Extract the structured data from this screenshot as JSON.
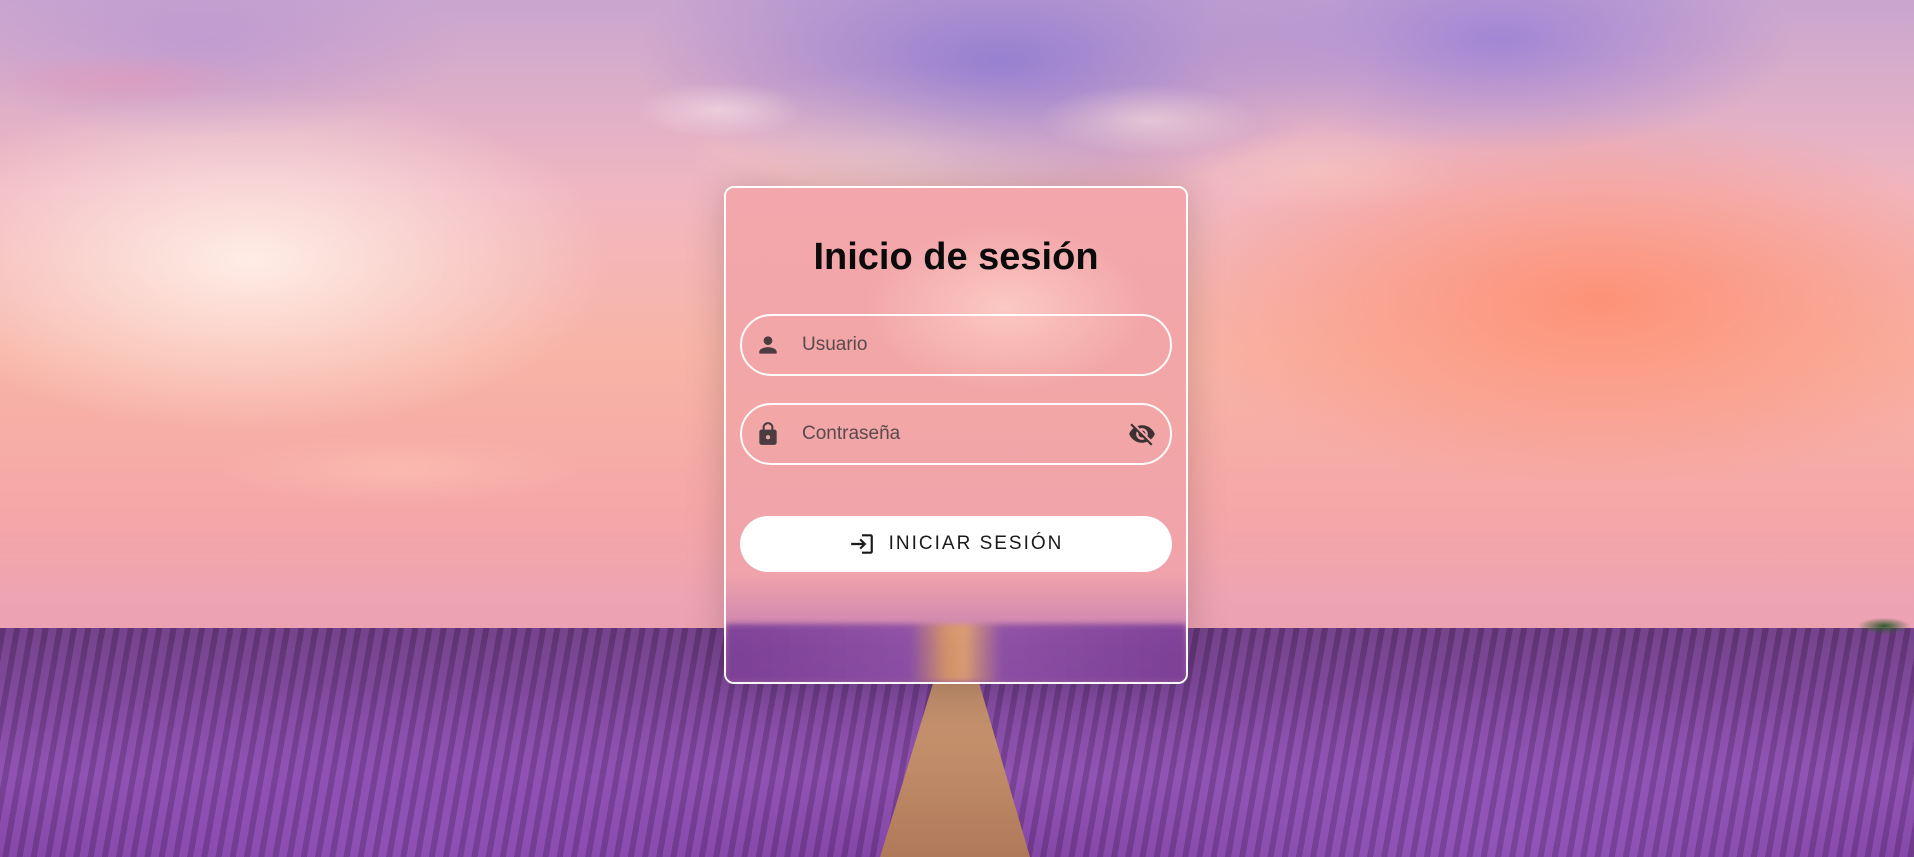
{
  "login": {
    "title": "Inicio de sesión",
    "username_placeholder": "Usuario",
    "password_placeholder": "Contraseña",
    "submit_label": "INICIAR SESIÓN"
  },
  "icons": {
    "username": "person-icon",
    "password": "lock-icon",
    "toggle_visibility": "eye-off-icon",
    "submit": "login-icon"
  },
  "colors": {
    "card_border": "#ffffff",
    "button_background": "#ffffff",
    "title_text": "#0b0b0b"
  }
}
